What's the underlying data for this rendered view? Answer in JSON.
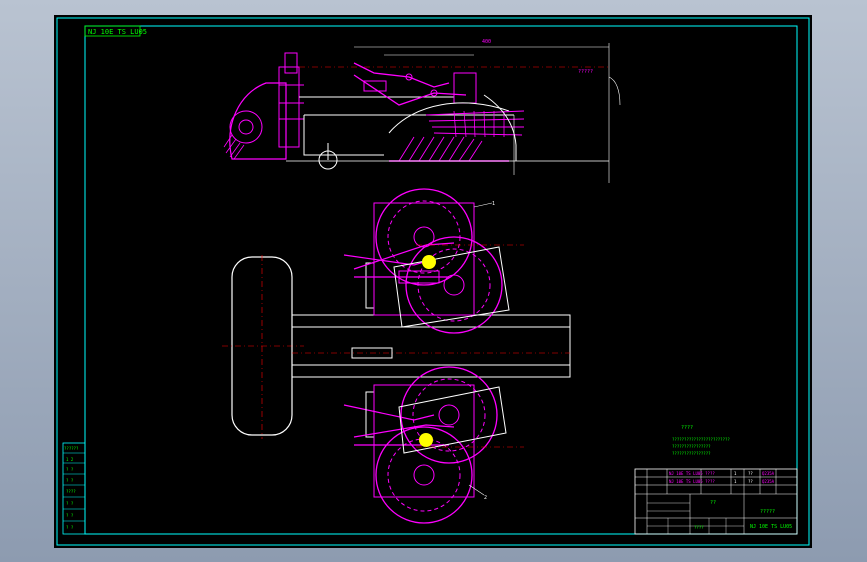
{
  "drawing": {
    "drawing_number": "NJ 10E TS LU05",
    "callouts": {
      "dim_top": "400",
      "note_top_right": "?????",
      "item_top": "1",
      "item_bottom": "2"
    },
    "notes": {
      "title": "????",
      "lines": [
        "????????????????????????",
        "????????????????",
        "????????????????"
      ]
    },
    "title_block": {
      "part_row_1": "NJ 10E TS LU05  ????",
      "part_row_2": "NJ 10E TS LU05  ????",
      "qty_1": "1",
      "qty_2": "1",
      "code_1": "??",
      "code_2": "??",
      "ref_1": "Q235A",
      "ref_2": "Q235A",
      "name": "??",
      "title": "?????",
      "drawing_no": "NJ 10E TS LU05",
      "company": "????"
    },
    "revision_table": {
      "header": "??????",
      "rows": [
        "1 2",
        "? ?",
        "? ?",
        "????",
        "? ?",
        "? ?",
        "? ?"
      ]
    }
  },
  "colors": {
    "background": "#000000",
    "frame": "#00ffff",
    "part": "#ff00ff",
    "line": "#ffffff",
    "centerline": "#ff0000",
    "text": "#00ff00",
    "highlight": "#ffff00"
  }
}
